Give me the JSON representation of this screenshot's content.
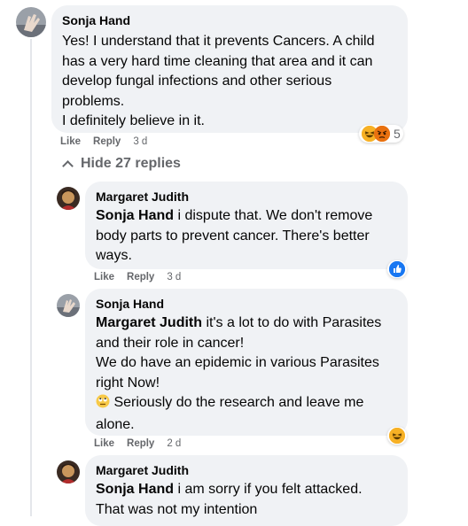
{
  "comments": [
    {
      "author": "Sonja Hand",
      "lines": [
        "Yes! I understand that it prevents Cancers. A child",
        "has a very hard time cleaning that area and it can",
        "develop fungal infections and other serious",
        "problems.",
        "I definitely believe in it."
      ],
      "like_label": "Like",
      "reply_label": "Reply",
      "time": "3 d",
      "reaction_count": "5"
    },
    {
      "author": "Margaret Judith",
      "mention": "Sonja Hand",
      "text_first": "i dispute that. We don't remove",
      "lines": [
        "body parts to prevent cancer. There's better",
        "ways."
      ],
      "like_label": "Like",
      "reply_label": "Reply",
      "time": "3 d"
    },
    {
      "author": "Sonja Hand",
      "mention": "Margaret Judith",
      "text_first": "it's a lot to do with Parasites",
      "lines": [
        "and their role in cancer!",
        "We do have an epidemic in various Parasites",
        "right Now!"
      ],
      "emoji_line": "Seriously do the research and leave me",
      "last_line": "alone.",
      "like_label": "Like",
      "reply_label": "Reply",
      "time": "2 d"
    },
    {
      "author": "Margaret Judith",
      "mention": "Sonja Hand",
      "text_first": "i am sorry if you felt attacked.",
      "lines": [
        "That was not my intention"
      ]
    }
  ],
  "hide_replies_label": "Hide 27 replies",
  "colors": {
    "bubble": "#f0f2f5",
    "meta": "#65676b",
    "like_blue": "#1877f2",
    "haha": "#f7b125",
    "angry": "#e9710f"
  },
  "icons": {
    "haha": "haha-reaction-icon",
    "angry": "angry-reaction-icon",
    "like": "like-reaction-icon",
    "eye_roll": "eye-roll-emoji-icon"
  }
}
